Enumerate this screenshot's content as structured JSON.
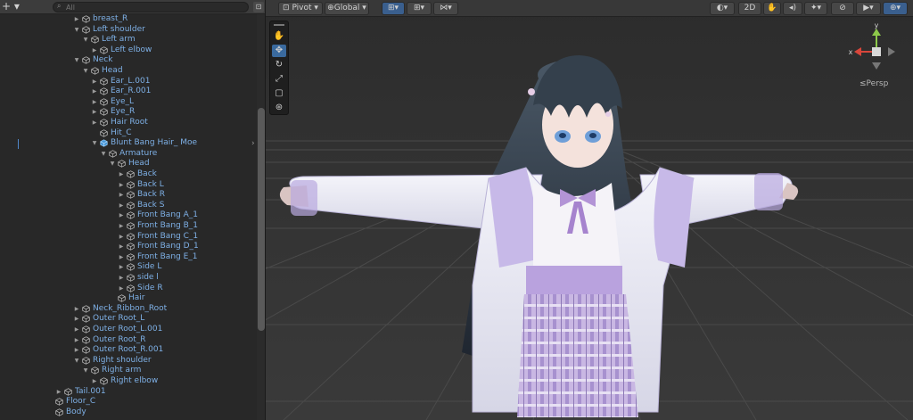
{
  "hierarchy": {
    "add_label": "+ ▾",
    "search_placeholder": "All",
    "rows": [
      {
        "depth": 5,
        "label": "breast_R",
        "arrow": "right"
      },
      {
        "depth": 5,
        "label": "Left shoulder",
        "arrow": "down"
      },
      {
        "depth": 6,
        "label": "Left arm",
        "arrow": "down"
      },
      {
        "depth": 7,
        "label": "Left elbow",
        "arrow": "right"
      },
      {
        "depth": 5,
        "label": "Neck",
        "arrow": "down"
      },
      {
        "depth": 6,
        "label": "Head",
        "arrow": "down"
      },
      {
        "depth": 7,
        "label": "Ear_L.001",
        "arrow": "right"
      },
      {
        "depth": 7,
        "label": "Ear_R.001",
        "arrow": "right"
      },
      {
        "depth": 7,
        "label": "Eye_L",
        "arrow": "right"
      },
      {
        "depth": 7,
        "label": "Eye_R",
        "arrow": "right"
      },
      {
        "depth": 7,
        "label": "Hair Root",
        "arrow": "right"
      },
      {
        "depth": 7,
        "label": "Hit_C",
        "arrow": "none"
      },
      {
        "depth": 7,
        "label": "Blunt Bang Hair_ Moe",
        "arrow": "down",
        "prefab": true
      },
      {
        "depth": 8,
        "label": "Armature",
        "arrow": "down"
      },
      {
        "depth": 9,
        "label": "Head",
        "arrow": "down"
      },
      {
        "depth": 10,
        "label": "Back",
        "arrow": "right"
      },
      {
        "depth": 10,
        "label": "Back L",
        "arrow": "right"
      },
      {
        "depth": 10,
        "label": "Back R",
        "arrow": "right"
      },
      {
        "depth": 10,
        "label": "Back S",
        "arrow": "right"
      },
      {
        "depth": 10,
        "label": "Front Bang A_1",
        "arrow": "right"
      },
      {
        "depth": 10,
        "label": "Front Bang B_1",
        "arrow": "right"
      },
      {
        "depth": 10,
        "label": "Front Bang C_1",
        "arrow": "right"
      },
      {
        "depth": 10,
        "label": "Front Bang D_1",
        "arrow": "right"
      },
      {
        "depth": 10,
        "label": "Front Bang E_1",
        "arrow": "right"
      },
      {
        "depth": 10,
        "label": "Side L",
        "arrow": "right"
      },
      {
        "depth": 10,
        "label": "side l",
        "arrow": "right"
      },
      {
        "depth": 10,
        "label": "Side R",
        "arrow": "right"
      },
      {
        "depth": 9,
        "label": "Hair",
        "arrow": "none"
      },
      {
        "depth": 5,
        "label": "Neck_Ribbon_Root",
        "arrow": "right"
      },
      {
        "depth": 5,
        "label": "Outer Root_L",
        "arrow": "right"
      },
      {
        "depth": 5,
        "label": "Outer Root_L.001",
        "arrow": "right"
      },
      {
        "depth": 5,
        "label": "Outer Root_R",
        "arrow": "right"
      },
      {
        "depth": 5,
        "label": "Outer Root_R.001",
        "arrow": "right"
      },
      {
        "depth": 5,
        "label": "Right shoulder",
        "arrow": "down"
      },
      {
        "depth": 6,
        "label": "Right arm",
        "arrow": "down"
      },
      {
        "depth": 7,
        "label": "Right elbow",
        "arrow": "right"
      },
      {
        "depth": 3,
        "label": "Tail.001",
        "arrow": "right"
      },
      {
        "depth": 2,
        "label": "Floor_C",
        "arrow": "none"
      },
      {
        "depth": 2,
        "label": "Body",
        "arrow": "none"
      }
    ]
  },
  "scene": {
    "pivot_label": "Pivot",
    "global_label": "Global",
    "mode_2d_label": "2D",
    "persp_label": "Persp",
    "gizmo_axes": {
      "y": "y",
      "x": "x"
    }
  },
  "colors": {
    "tree_label": "#7eb0e6",
    "panel_bg": "#282828",
    "scene_bg": "#2e2e2e",
    "gizmo_x": "#d9463b",
    "gizmo_y": "#8dc94a",
    "gizmo_z": "#4a7ede"
  }
}
